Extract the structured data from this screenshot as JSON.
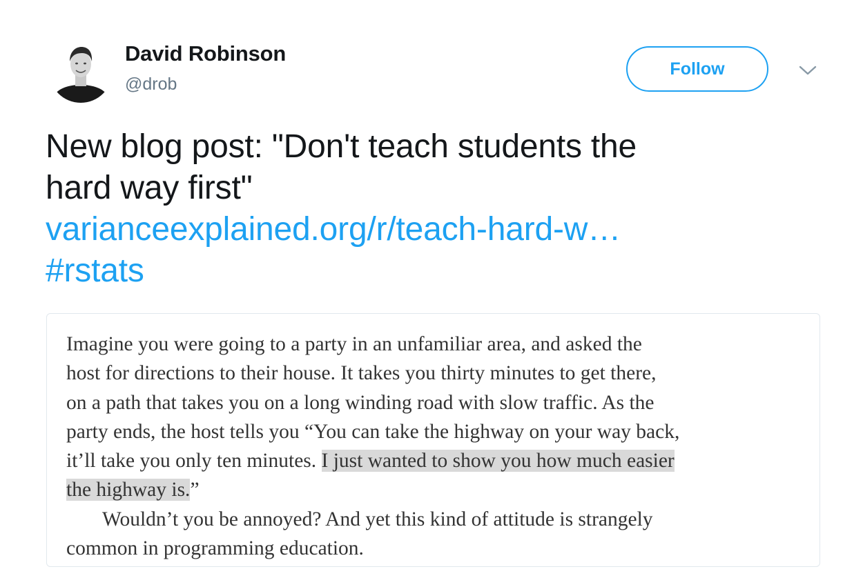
{
  "author": {
    "display_name": "David Robinson",
    "handle": "@drob"
  },
  "header": {
    "follow_label": "Follow",
    "more_icon": "chevron-down-icon"
  },
  "tweet": {
    "text_lines": [
      "New blog post: \"Don't teach students the",
      "hard way first\""
    ],
    "link": "varianceexplained.org/r/teach-hard-w…",
    "hashtag": "#rstats"
  },
  "excerpt": {
    "lines": [
      "Imagine you were going to a party in an unfamiliar area, and asked the",
      "host for directions to their house. It takes you thirty minutes to get there,",
      "on a path that takes you on a long winding road with slow traffic. As the",
      "party ends, the host tells you “You can take the highway on your way back,"
    ],
    "line5_plain": "it’ll take you only ten minutes. ",
    "line5_highlight": "I just wanted to show you how much easier",
    "line6_highlight": "the highway is.",
    "line6_plain": "”",
    "paragraph2_lines": [
      "Wouldn’t you be annoyed? And yet this kind of attitude is strangely",
      "common in programming education."
    ]
  },
  "colors": {
    "accent": "#1da1f2",
    "secondary_text": "#657786",
    "highlight": "#d9d9d9"
  }
}
